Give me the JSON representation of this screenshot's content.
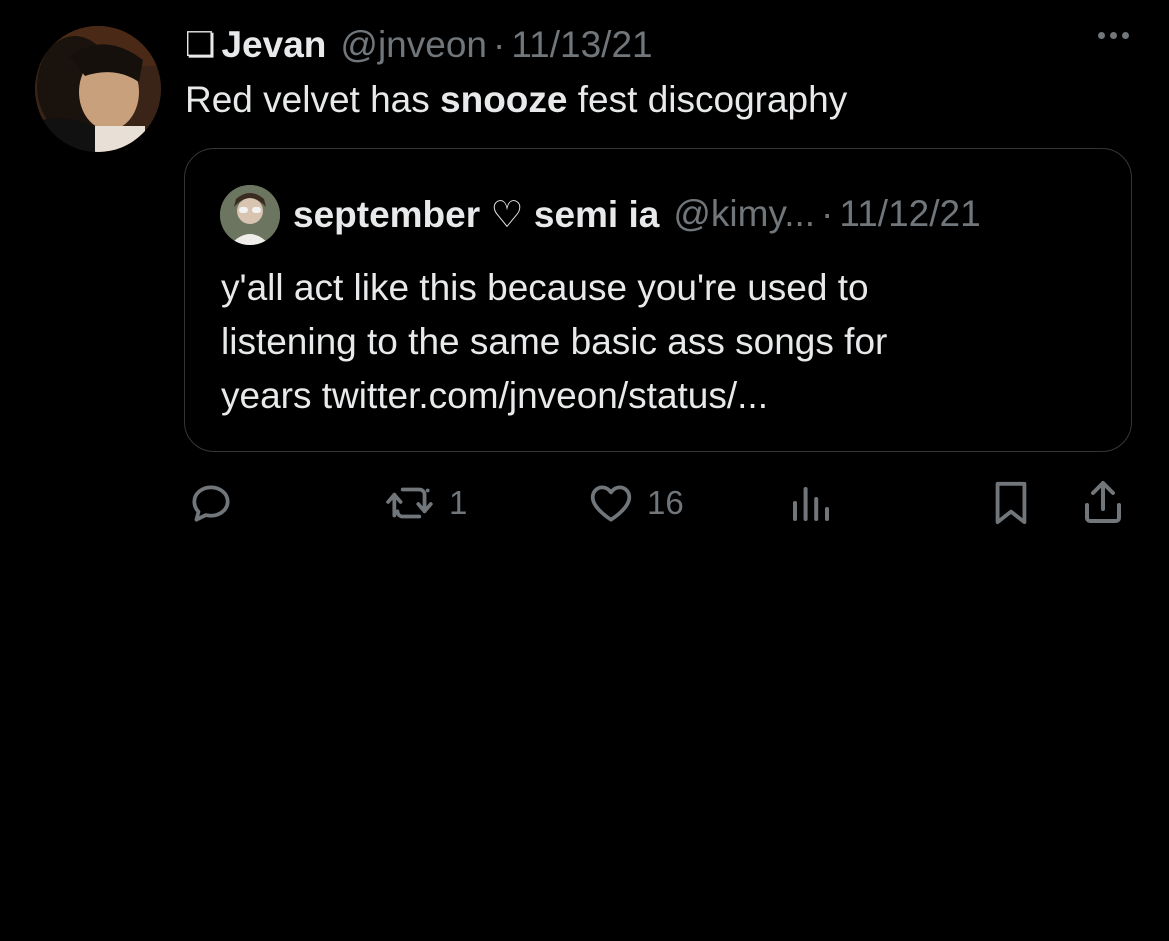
{
  "tweet": {
    "glyph": "❏",
    "author": {
      "display_name": "Jevan",
      "handle": "@jnveon",
      "date": "11/13/21"
    },
    "separator": "·",
    "text_before": "Red velvet has ",
    "text_bold": "snooze",
    "text_after": " fest discography",
    "quoted": {
      "display_name": "september ♡ semi ia",
      "handle": "@kimy...",
      "date": "11/12/21",
      "text": "y'all act like this because you're used to\nlistening to the same basic ass songs for\nyears twitter.com/jnveon/status/..."
    },
    "actions": {
      "reply_icon": "reply-icon",
      "retweet_count": "1",
      "like_count": "16",
      "views_icon": "views-icon",
      "bookmark_icon": "bookmark-icon",
      "share_icon": "share-icon"
    }
  },
  "colors": {
    "background": "#000000",
    "primary_text": "#e7e9ea",
    "secondary_text": "#71767b",
    "border": "#333639"
  }
}
